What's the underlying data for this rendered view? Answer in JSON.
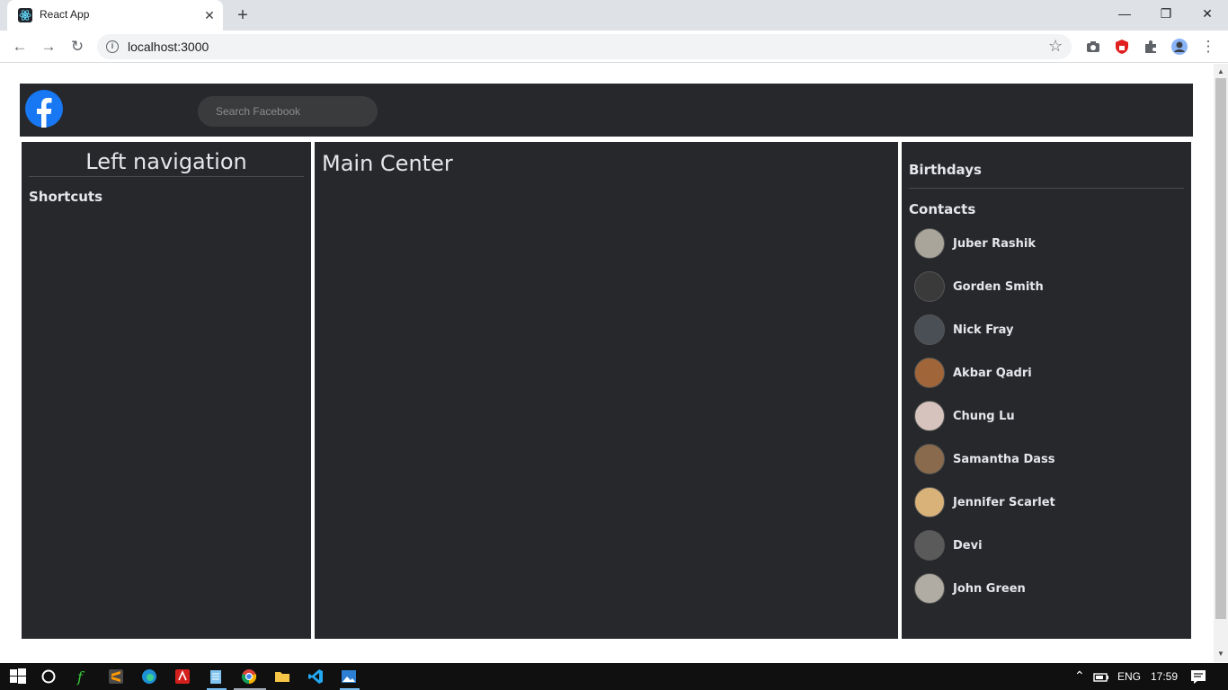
{
  "browser": {
    "tab_title": "React App",
    "tab_close": "✕",
    "new_tab": "+",
    "url": "localhost:3000",
    "win_minimize": "—",
    "win_restore": "❐",
    "win_close": "✕"
  },
  "header": {
    "search_placeholder": "Search Facebook"
  },
  "left_nav": {
    "title": "Left navigation",
    "shortcuts": "Shortcuts"
  },
  "main": {
    "title": "Main Center"
  },
  "right_bar": {
    "birthdays": "Birthdays",
    "contacts_title": "Contacts",
    "contacts": [
      {
        "name": "Juber Rashik",
        "avatar_color": "#a9a59b"
      },
      {
        "name": "Gorden Smith",
        "avatar_color": "#3a3a3a"
      },
      {
        "name": "Nick Fray",
        "avatar_color": "#4a4f56"
      },
      {
        "name": "Akbar Qadri",
        "avatar_color": "#a0663a"
      },
      {
        "name": "Chung Lu",
        "avatar_color": "#d6c3bd"
      },
      {
        "name": "Samantha Dass",
        "avatar_color": "#8a6a4c"
      },
      {
        "name": "Jennifer Scarlet",
        "avatar_color": "#d9b27a"
      },
      {
        "name": "Devi",
        "avatar_color": "#5a5a5a"
      },
      {
        "name": "John Green",
        "avatar_color": "#b0aca3"
      }
    ]
  },
  "taskbar": {
    "language": "ENG",
    "time": "17:59"
  },
  "colors": {
    "panel_bg": "#27282b",
    "fb_blue": "#1877f2"
  }
}
